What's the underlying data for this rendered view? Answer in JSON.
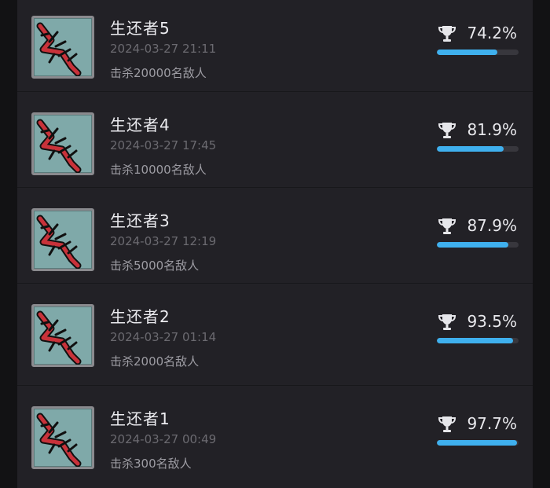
{
  "achievements": [
    {
      "title": "生还者5",
      "time": "2024-03-27 21:11",
      "desc": "击杀20000名敌人",
      "percent_label": "74.2%",
      "percent": 74.2
    },
    {
      "title": "生还者4",
      "time": "2024-03-27 17:45",
      "desc": "击杀10000名敌人",
      "percent_label": "81.9%",
      "percent": 81.9
    },
    {
      "title": "生还者3",
      "time": "2024-03-27 12:19",
      "desc": "击杀5000名敌人",
      "percent_label": "87.9%",
      "percent": 87.9
    },
    {
      "title": "生还者2",
      "time": "2024-03-27 01:14",
      "desc": "击杀2000名敌人",
      "percent_label": "93.5%",
      "percent": 93.5
    },
    {
      "title": "生还者1",
      "time": "2024-03-27 00:49",
      "desc": "击杀300名敌人",
      "percent_label": "97.7%",
      "percent": 97.7
    }
  ],
  "colors": {
    "progress_fill": "#3fb0ee",
    "icon_background": "#7fa9a9",
    "icon_mark": "#c8323a"
  },
  "icon_names": {
    "achievement_icon": "barbed-slash-icon",
    "rarity_icon": "trophy-icon"
  }
}
